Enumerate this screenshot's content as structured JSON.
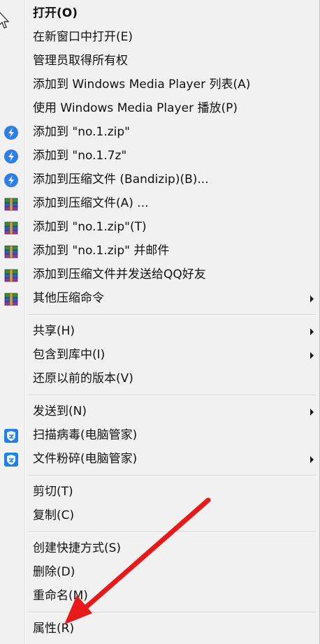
{
  "menu": {
    "open": "打开(O)",
    "open_new_window": "在新窗口中打开(E)",
    "take_ownership": "管理员取得所有权",
    "add_wmp_list": "添加到 Windows Media Player 列表(A)",
    "play_wmp": "使用 Windows Media Player 播放(P)",
    "bandizip_add_zip": "添加到 \"no.1.zip\"",
    "bandizip_add_7z": "添加到 \"no.1.7z\"",
    "bandizip_add_archive": "添加到压缩文件 (Bandizip)(B)...",
    "winrar_add_archive": "添加到压缩文件(A) ...",
    "winrar_add_zip": "添加到 \"no.1.zip\"(T)",
    "winrar_add_zip_email": "添加到 \"no.1.zip\" 并邮件",
    "winrar_add_send_qq": "添加到压缩文件并发送给QQ好友",
    "other_compress": "其他压缩命令",
    "share": "共享(H)",
    "include_library": "包含到库中(I)",
    "restore_versions": "还原以前的版本(V)",
    "send_to": "发送到(N)",
    "scan_virus": "扫描病毒(电脑管家)",
    "shred_file": "文件粉碎(电脑管家)",
    "cut": "剪切(T)",
    "copy": "复制(C)",
    "create_shortcut": "创建快捷方式(S)",
    "delete": "删除(D)",
    "rename": "重命名(M)",
    "properties": "属性(R)"
  },
  "icons": {
    "bandizip": "bandizip-icon",
    "winrar": "winrar-icon",
    "pc_manager": "tencent-pc-manager-shield-icon",
    "submenu": "submenu-arrow-icon",
    "cursor": "mouse-pointer-icon"
  },
  "colors": {
    "menu_bg": "#f1f1f1",
    "bandizip_blue": "#2f7ee6",
    "shield_blue": "#1a82e8",
    "annotation_red": "#e8191a"
  }
}
